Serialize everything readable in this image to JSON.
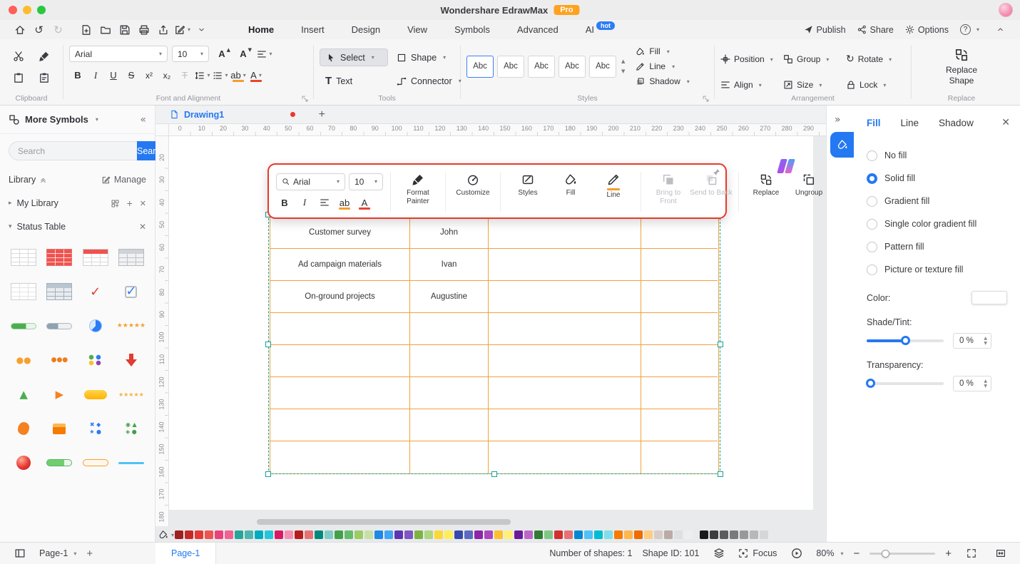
{
  "titlebar": {
    "title": "Wondershare EdrawMax",
    "badge": "Pro"
  },
  "menubar": {
    "tabs": [
      {
        "label": "Home"
      },
      {
        "label": "Insert"
      },
      {
        "label": "Design"
      },
      {
        "label": "View"
      },
      {
        "label": "Symbols"
      },
      {
        "label": "Advanced"
      },
      {
        "label": "AI",
        "badge": "hot"
      }
    ],
    "publish": "Publish",
    "share": "Share",
    "options": "Options",
    "help": "?"
  },
  "ribbon": {
    "clipboard": {
      "label": "Clipboard"
    },
    "font": {
      "label": "Font and Alignment",
      "family": "Arial",
      "size": "10",
      "bold": "B",
      "italic": "I",
      "underline": "U",
      "strike": "S",
      "superscript": "x²",
      "subscript": "x₂",
      "clear": "T",
      "highlight": "ab",
      "color": "A",
      "grow": "A",
      "shrink": "A"
    },
    "tools": {
      "label": "Tools",
      "select": "Select",
      "shape": "Shape",
      "text": "Text",
      "connector": "Connector"
    },
    "styles": {
      "label": "Styles",
      "previews": [
        "Abc",
        "Abc",
        "Abc",
        "Abc",
        "Abc"
      ],
      "fill": "Fill",
      "line": "Line",
      "shadow": "Shadow"
    },
    "arrangement": {
      "label": "Arrangement",
      "position": "Position",
      "group": "Group",
      "rotate": "Rotate",
      "align": "Align",
      "size": "Size",
      "lock": "Lock"
    },
    "replace": {
      "label": "Replace",
      "line1": "Replace",
      "line2": "Shape"
    }
  },
  "sidebar": {
    "header": "More Symbols",
    "search": {
      "placeholder": "Search",
      "button": "Search"
    },
    "library": "Library",
    "manage": "Manage",
    "my_library": "My Library",
    "section": "Status Table",
    "symbols": [
      {
        "name": "table-white",
        "cls": "t-plain"
      },
      {
        "name": "table-red",
        "cls": "t-red"
      },
      {
        "name": "table-red-header",
        "cls": "t-redhead"
      },
      {
        "name": "table-gray",
        "cls": "t-gray"
      },
      {
        "name": "table-light",
        "cls": "t-light"
      },
      {
        "name": "table-blue-gray",
        "cls": "t-bluegray"
      },
      {
        "name": "checkmark-red",
        "glyph": "✓",
        "color": "#e03c31",
        "cls": "g18"
      },
      {
        "name": "checkbox-checked",
        "glyph": "✓",
        "cls": "chk"
      },
      {
        "name": "progress-bar-green",
        "cls": "bar-green"
      },
      {
        "name": "progress-bar-gray",
        "cls": "bar-gray"
      },
      {
        "name": "clock-blue",
        "cls": "pie-blue"
      },
      {
        "name": "stars-orange",
        "glyph": "★★★★★",
        "color": "#f5a12e",
        "cls": "g9"
      },
      {
        "name": "dots-orange-pair",
        "glyph": "●●",
        "color": "#f5a12e",
        "cls": "g12"
      },
      {
        "name": "dots-orange-trio",
        "glyph": "●●●",
        "color": "#ef7d1a",
        "cls": "g9"
      },
      {
        "name": "dots-multicolor",
        "cls": "dotgrid"
      },
      {
        "name": "arrow-down-red",
        "cls": "arrdown"
      },
      {
        "name": "triangle-green",
        "glyph": "▲",
        "color": "#4cae4f",
        "cls": "g14"
      },
      {
        "name": "triangle-orange",
        "glyph": "▶",
        "color": "#f58220",
        "cls": "g14"
      },
      {
        "name": "pill-yellow",
        "cls": "pill-yellow"
      },
      {
        "name": "stars-orange-small",
        "glyph": "★★★★★",
        "color": "#f6b33c",
        "cls": "g8"
      },
      {
        "name": "hand-orange",
        "cls": "blob-orange"
      },
      {
        "name": "box-orange",
        "cls": "box-orange"
      },
      {
        "name": "marks-blue",
        "glyph": "✖ ◆\n★ ●",
        "color": "#2b7cf7",
        "cls": "g8 pre"
      },
      {
        "name": "marks-green",
        "glyph": "◉ ▲\n◈ ●",
        "color": "#43a047",
        "cls": "g8 pre"
      },
      {
        "name": "sphere-red",
        "cls": "sphere-red"
      },
      {
        "name": "capsule-green",
        "cls": "cap-green"
      },
      {
        "name": "capsule-orange",
        "cls": "cap-orange"
      },
      {
        "name": "line-blue",
        "cls": "line-blue"
      }
    ]
  },
  "canvas": {
    "tab": "Drawing1",
    "h_ruler": {
      "start": 0,
      "end": 290,
      "step": 10
    },
    "v_ruler": {
      "start": 20,
      "end": 180,
      "step": 10
    },
    "floating_toolbar": {
      "font": "Arial",
      "size": "10",
      "bold": "B",
      "italic": "I",
      "highlight": "ab",
      "color": "A",
      "buttons": [
        {
          "label": "Format Painter"
        },
        {
          "label": "Customize"
        },
        {
          "label": "Styles"
        },
        {
          "label": "Fill"
        },
        {
          "label": "Line"
        },
        {
          "label": "Bring to Front",
          "disabled": true
        },
        {
          "label": "Send to Back",
          "disabled": true
        },
        {
          "label": "Replace"
        },
        {
          "label": "Ungroup"
        }
      ]
    },
    "table": {
      "rows": [
        [
          "Customer survey",
          "John",
          "",
          ""
        ],
        [
          "Ad campaign materials",
          "Ivan",
          "",
          ""
        ],
        [
          "On-ground projects",
          "Augustine",
          "",
          ""
        ],
        [
          "",
          "",
          "",
          ""
        ],
        [
          "",
          "",
          "",
          ""
        ],
        [
          "",
          "",
          "",
          ""
        ],
        [
          "",
          "",
          "",
          ""
        ],
        [
          "",
          "",
          "",
          ""
        ]
      ]
    }
  },
  "right_panel": {
    "tabs": [
      {
        "label": "Fill",
        "active": true
      },
      {
        "label": "Line"
      },
      {
        "label": "Shadow"
      }
    ],
    "options": [
      {
        "label": "No fill"
      },
      {
        "label": "Solid fill",
        "selected": true
      },
      {
        "label": "Gradient fill"
      },
      {
        "label": "Single color gradient fill"
      },
      {
        "label": "Pattern fill"
      },
      {
        "label": "Picture or texture fill"
      }
    ],
    "color_label": "Color:",
    "shade": {
      "label": "Shade/Tint:",
      "value": "0 %"
    },
    "transparency": {
      "label": "Transparency:",
      "value": "0 %"
    }
  },
  "palette": {
    "colors": [
      "#9e1f1f",
      "#c62828",
      "#e53935",
      "#ef5350",
      "#ec407a",
      "#f06292",
      "#26a69a",
      "#4db6ac",
      "#00acc1",
      "#26c6da",
      "#d81b60",
      "#f48fb1",
      "#b71c1c",
      "#e57373",
      "#00897b",
      "#80cbc4",
      "#43a047",
      "#66bb6a",
      "#9ccc65",
      "#c5e1a5",
      "#1e88e5",
      "#42a5f5",
      "#5e35b1",
      "#7e57c2",
      "#7cb342",
      "#aed581",
      "#fdd835",
      "#ffee58",
      "#3949ab",
      "#5c6bc0",
      "#8e24aa",
      "#ab47bc",
      "#fbc02d",
      "#fff176",
      "#6a1b9a",
      "#ba68c8",
      "#2e7d32",
      "#81c784",
      "#d32f2f",
      "#e57373",
      "#0288d1",
      "#4fc3f7",
      "#00bcd4",
      "#80deea",
      "#f57c00",
      "#ffb74d",
      "#ef6c00",
      "#ffcc80",
      "#d7ccc8",
      "#bcaaa4",
      "#e0e0e0",
      "#eeeeee"
    ],
    "grays": [
      "#1a1a1a",
      "#3d3d3d",
      "#5c5c5c",
      "#7a7a7a",
      "#999999",
      "#b8b8b8",
      "#d6d6d6"
    ]
  },
  "statusbar": {
    "page_dropdown": "Page-1",
    "add_page": "+",
    "page_tab": "Page-1",
    "shapes": "Number of shapes: 1",
    "shape_id": "Shape ID: 101",
    "focus": "Focus",
    "zoom": "80%"
  }
}
